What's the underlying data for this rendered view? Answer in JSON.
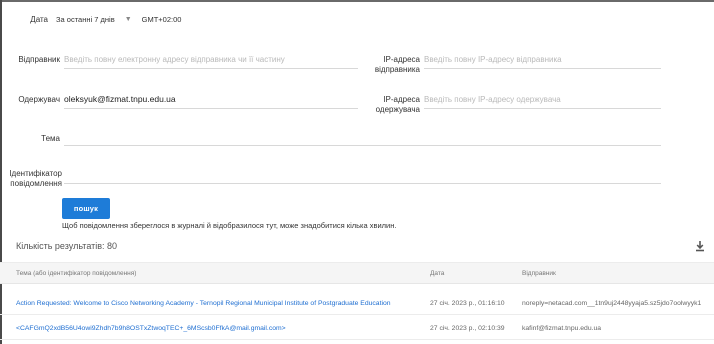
{
  "filters": {
    "date_label": "Дата",
    "date_value": "За останні 7 днів",
    "timezone": "GMT+02:00",
    "sender_label": "Відправник",
    "sender_placeholder": "Введіть повну електронну адресу відправника чи її частину",
    "sender_ip_label_1": "IP-адреса",
    "sender_ip_label_2": "відправника",
    "sender_ip_placeholder": "Введіть повну IP-адресу відправника",
    "recipient_label": "Одержувач",
    "recipient_value": "oleksyuk@fizmat.tnpu.edu.ua",
    "recipient_ip_label_1": "IP-адреса",
    "recipient_ip_label_2": "одержувача",
    "recipient_ip_placeholder": "Введіть повну IP-адресу одержувача",
    "subject_label": "Тема",
    "message_id_label_1": "Ідентифікатор",
    "message_id_label_2": "повідомлення"
  },
  "search": {
    "button_label": "пошук",
    "hint": "Щоб повідомлення збереглося в журналі й відобразилося тут, може знадобитися кілька хвилин."
  },
  "results": {
    "count_label": "Кількість результатів: 80",
    "columns": [
      "Тема (або ідентифікатор повідомлення)",
      "Дата",
      "Відправник"
    ],
    "rows": [
      {
        "subject": "Action Requested: Welcome to Cisco Networking Academy - Ternopil Regional Municipal Institute of Postgraduate Education",
        "date": "27 січ. 2023 р., 01:16:10",
        "sender": "noreply=netacad.com__1tn9uj2448yyaja5.sz5jdo7oolwyyk1"
      },
      {
        "subject": "<CAFGmQ2xdB56U4owi9Zhdh7b9h8OSTxZtwoqTEC+_6MScsb0FfkA@mail.gmail.com>",
        "date": "27 січ. 2023 р., 02:10:39",
        "sender": "kafinf@fizmat.tnpu.edu.ua"
      }
    ]
  },
  "colors": {
    "accent": "#1e7cd8",
    "link": "#1e6ed1"
  },
  "icons": {
    "download": "download-icon",
    "dropdown": "chevron-down-icon"
  }
}
